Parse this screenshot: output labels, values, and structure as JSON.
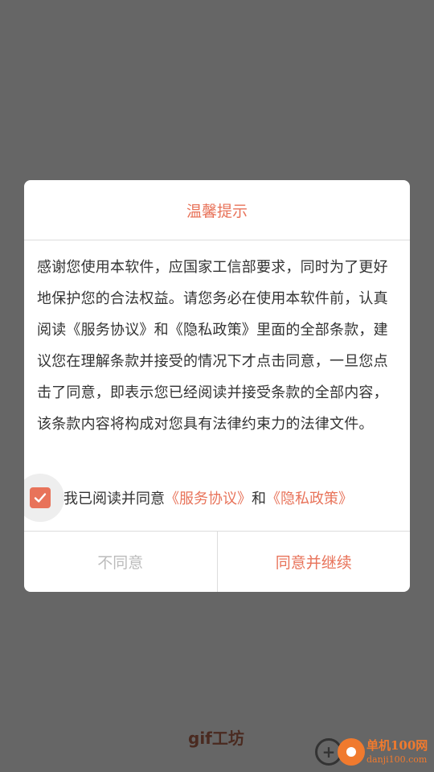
{
  "dialog": {
    "title": "温馨提示",
    "body": "感谢您使用本软件，应国家工信部要求，同时为了更好地保护您的合法权益。请您务必在使用本软件前，认真阅读《服务协议》和《隐私政策》里面的全部条款，建议您在理解条款并接受的情况下才点击同意，一旦您点击了同意，即表示您已经阅读并接受条款的全部内容，该条款内容将构成对您具有法律约束力的法律文件。",
    "consent": {
      "checked": true,
      "prefix": "我已阅读并同意",
      "service_link": "《服务协议》",
      "conjunction": "和",
      "privacy_link": "《隐私政策》"
    },
    "buttons": {
      "disagree": "不同意",
      "agree": "同意并继续"
    }
  },
  "watermarks": {
    "gif": "gif工坊",
    "brand": "单机100网",
    "domain": "danji100.com"
  },
  "colors": {
    "accent": "#e8735a",
    "overlay": "#666666"
  },
  "icons": {
    "checkbox": "checkmark-icon"
  }
}
